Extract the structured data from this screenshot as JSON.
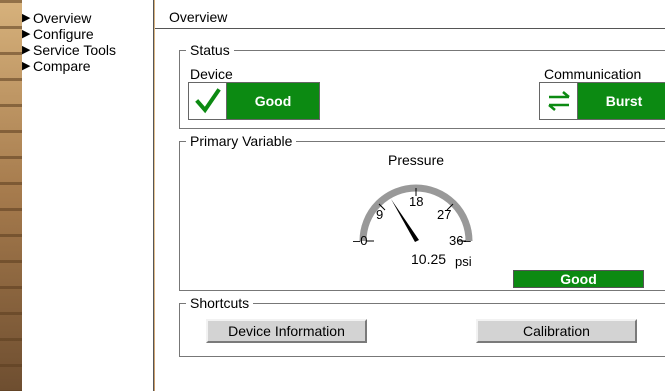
{
  "nav": {
    "items": [
      {
        "label": "Overview"
      },
      {
        "label": "Configure"
      },
      {
        "label": "Service Tools"
      },
      {
        "label": "Compare"
      }
    ]
  },
  "main": {
    "title": "Overview"
  },
  "status": {
    "legend": "Status",
    "device_label": "Device",
    "device_state": "Good",
    "communication_label": "Communication",
    "communication_state": "Burst",
    "good_color": "#0c8a12"
  },
  "primary_variable": {
    "legend": "Primary Variable",
    "title": "Pressure",
    "value": "10.25",
    "unit": "psi",
    "status": "Good",
    "scale_min": 0,
    "scale_max": 36,
    "ticks": [
      "0",
      "9",
      "18",
      "27",
      "36"
    ]
  },
  "shortcuts": {
    "legend": "Shortcuts",
    "device_information": "Device Information",
    "calibration": "Calibration"
  }
}
